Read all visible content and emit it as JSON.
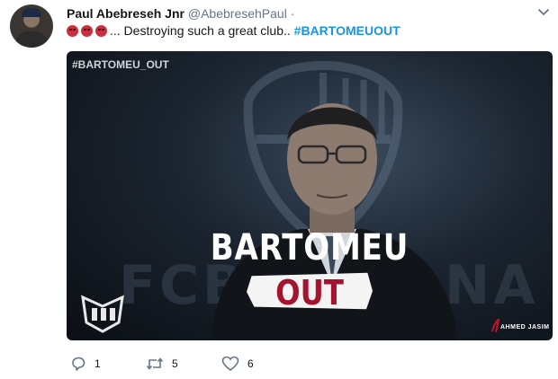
{
  "tweet": {
    "display_name": "Paul Abebreseh Jnr",
    "handle": "@AbebresehPaul",
    "separator": " ·",
    "emojis": [
      "angry-face",
      "angry-face",
      "angry-face"
    ],
    "text": "... Destroying such a great club.. ",
    "hashtag": "#BARTOMEUOUT"
  },
  "media": {
    "corner_tag": "#BARTOMEU_OUT",
    "headline_1": "BARTOMEU",
    "headline_2": "OUT",
    "credit": "AHMED JASIM",
    "watermark_left": "FCB",
    "watermark_right": "NA"
  },
  "actions": {
    "reply_count": "1",
    "retweet_count": "5",
    "like_count": "6"
  },
  "colors": {
    "link": "#1b95e0",
    "meta": "#657786",
    "out_red": "#a5142f"
  }
}
